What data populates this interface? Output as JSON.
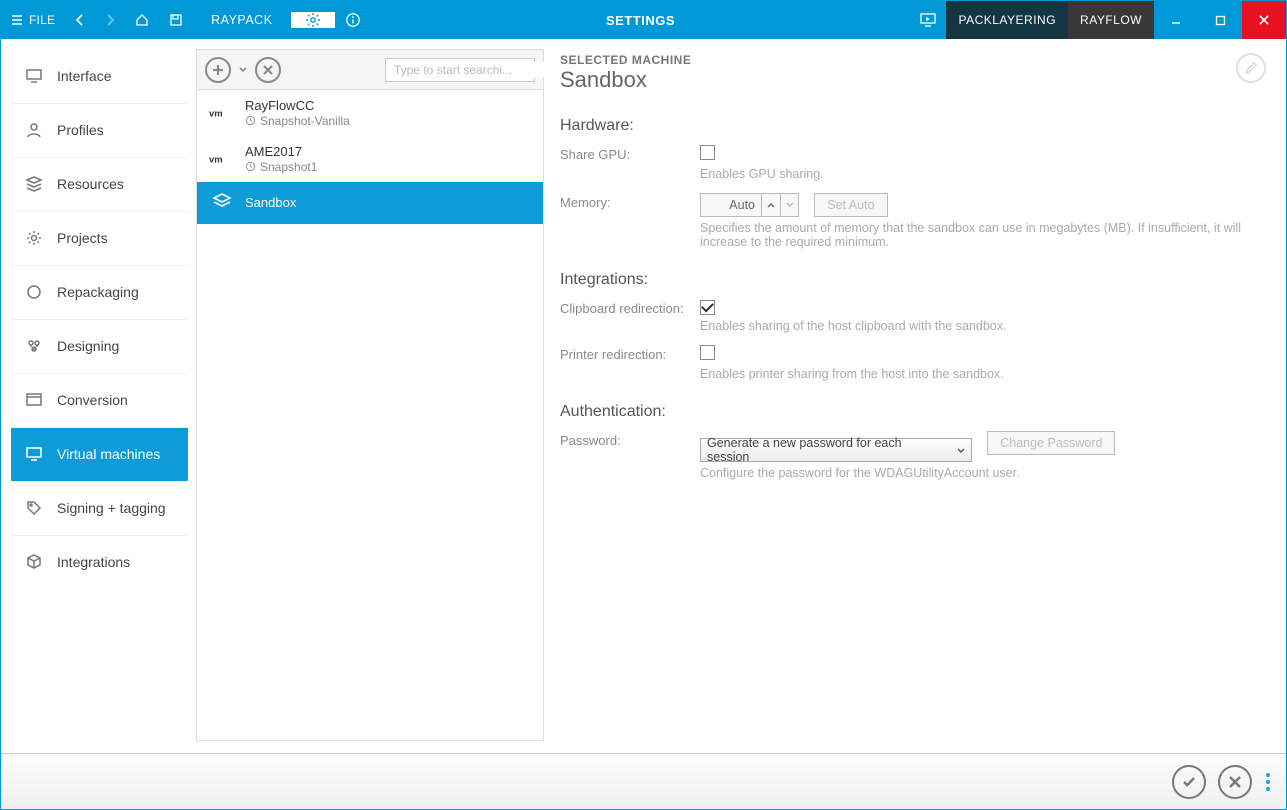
{
  "titlebar": {
    "file_label": "FILE",
    "app_name": "RAYPACK",
    "center_title": "SETTINGS",
    "pill1": "PACKLAYERING",
    "pill2": "RAYFLOW"
  },
  "sidebar": {
    "items": [
      {
        "id": "interface",
        "label": "Interface"
      },
      {
        "id": "profiles",
        "label": "Profiles"
      },
      {
        "id": "resources",
        "label": "Resources"
      },
      {
        "id": "projects",
        "label": "Projects"
      },
      {
        "id": "repackaging",
        "label": "Repackaging"
      },
      {
        "id": "designing",
        "label": "Designing"
      },
      {
        "id": "conversion",
        "label": "Conversion"
      },
      {
        "id": "virtual-machines",
        "label": "Virtual machines"
      },
      {
        "id": "signing-tagging",
        "label": "Signing + tagging"
      },
      {
        "id": "integrations",
        "label": "Integrations"
      }
    ],
    "selected": "virtual-machines"
  },
  "mid": {
    "search_placeholder": "Type to start searchi...",
    "machines": [
      {
        "id": "rayflowcc",
        "title": "RayFlowCC",
        "subtitle": "Snapshot-Vanilla",
        "type": "vm"
      },
      {
        "id": "ame2017",
        "title": "AME2017",
        "subtitle": "Snapshot1",
        "type": "vm"
      },
      {
        "id": "sandbox",
        "title": "Sandbox",
        "subtitle": "",
        "type": "sandbox"
      }
    ],
    "selected": "sandbox"
  },
  "details": {
    "eyebrow": "SELECTED MACHINE",
    "title": "Sandbox",
    "sections": {
      "hardware": {
        "title": "Hardware:",
        "share_gpu": {
          "label": "Share GPU:",
          "checked": false,
          "help": "Enables GPU sharing."
        },
        "memory": {
          "label": "Memory:",
          "value": "Auto",
          "set_auto_label": "Set Auto",
          "help": "Specifies the amount of memory that the sandbox can use in megabytes (MB). If insufficient, it will increase to the required minimum."
        }
      },
      "integrations": {
        "title": "Integrations:",
        "clipboard": {
          "label": "Clipboard redirection:",
          "checked": true,
          "help": "Enables sharing of the host clipboard with the sandbox."
        },
        "printer": {
          "label": "Printer redirection:",
          "checked": false,
          "help": "Enables printer sharing from the host into the sandbox."
        }
      },
      "auth": {
        "title": "Authentication:",
        "password": {
          "label": "Password:",
          "selected": "Generate a new password for each session",
          "change_label": "Change Password",
          "help": "Configure the password for the WDAGUtilityAccount user."
        }
      }
    }
  }
}
